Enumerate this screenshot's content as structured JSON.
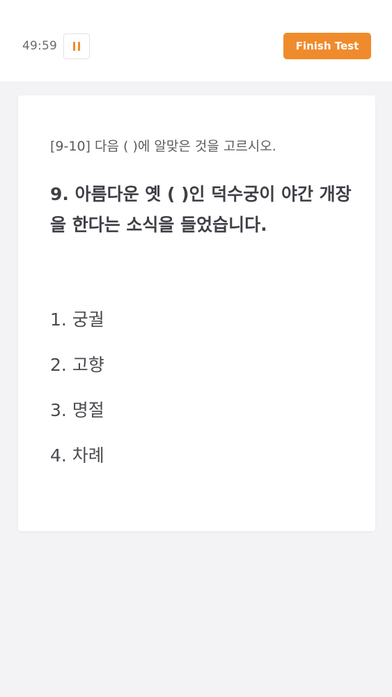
{
  "header": {
    "timer": "49:59",
    "pause_icon": "pause-icon",
    "finish_label": "Finish Test"
  },
  "question": {
    "instruction": "[9-10] 다음 (        )에 알맞은 것을 고르시오.",
    "text": "9. 아름다운 옛 (     )인 덕수궁이 야간 개장을 한다는 소식을 들었습니다.",
    "options": [
      "1. 궁궐",
      "2. 고향",
      "3. 명절",
      "4. 차례"
    ]
  },
  "colors": {
    "accent": "#ef8b2c",
    "background": "#f3f3f5",
    "card": "#ffffff",
    "text": "#3f3f46"
  }
}
